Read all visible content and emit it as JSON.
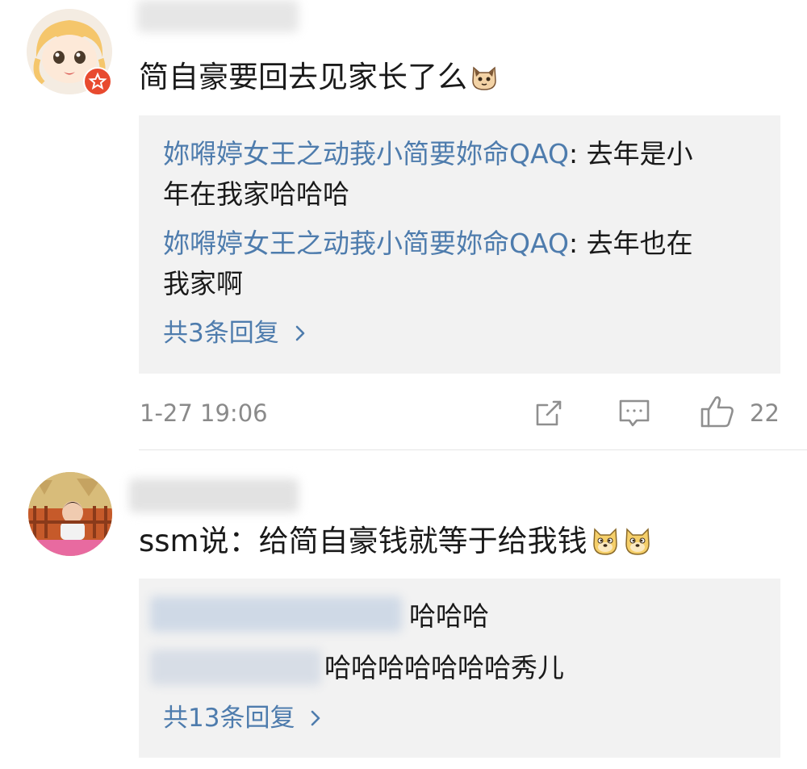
{
  "comments": [
    {
      "text": "简自豪要回去见家长了么",
      "emoji": "cat-emoji",
      "replies": [
        {
          "author": "妳嘚婷女王之动莪小简要妳命QAQ",
          "sep": ":",
          "text1": " 去年是小",
          "text2": "年在我家哈哈哈"
        },
        {
          "author": "妳嘚婷女王之动莪小简要妳命QAQ",
          "sep": ":",
          "text1": " 去年也在",
          "text2": "我家啊"
        }
      ],
      "more": "共3条回复",
      "time": "1-27 19:06",
      "likes": "22"
    },
    {
      "text": "ssm说：给简自豪钱就等于给我钱",
      "emoji": "doge-emoji",
      "replies": [
        {
          "text": "哈哈哈"
        },
        {
          "text": "哈哈哈哈哈哈哈秀儿"
        }
      ],
      "more": "共13条回复"
    }
  ],
  "colors": {
    "link": "#4e7cad",
    "box": "#f2f2f2",
    "meta": "#8a8a8a",
    "badge": "#e84a2f"
  }
}
